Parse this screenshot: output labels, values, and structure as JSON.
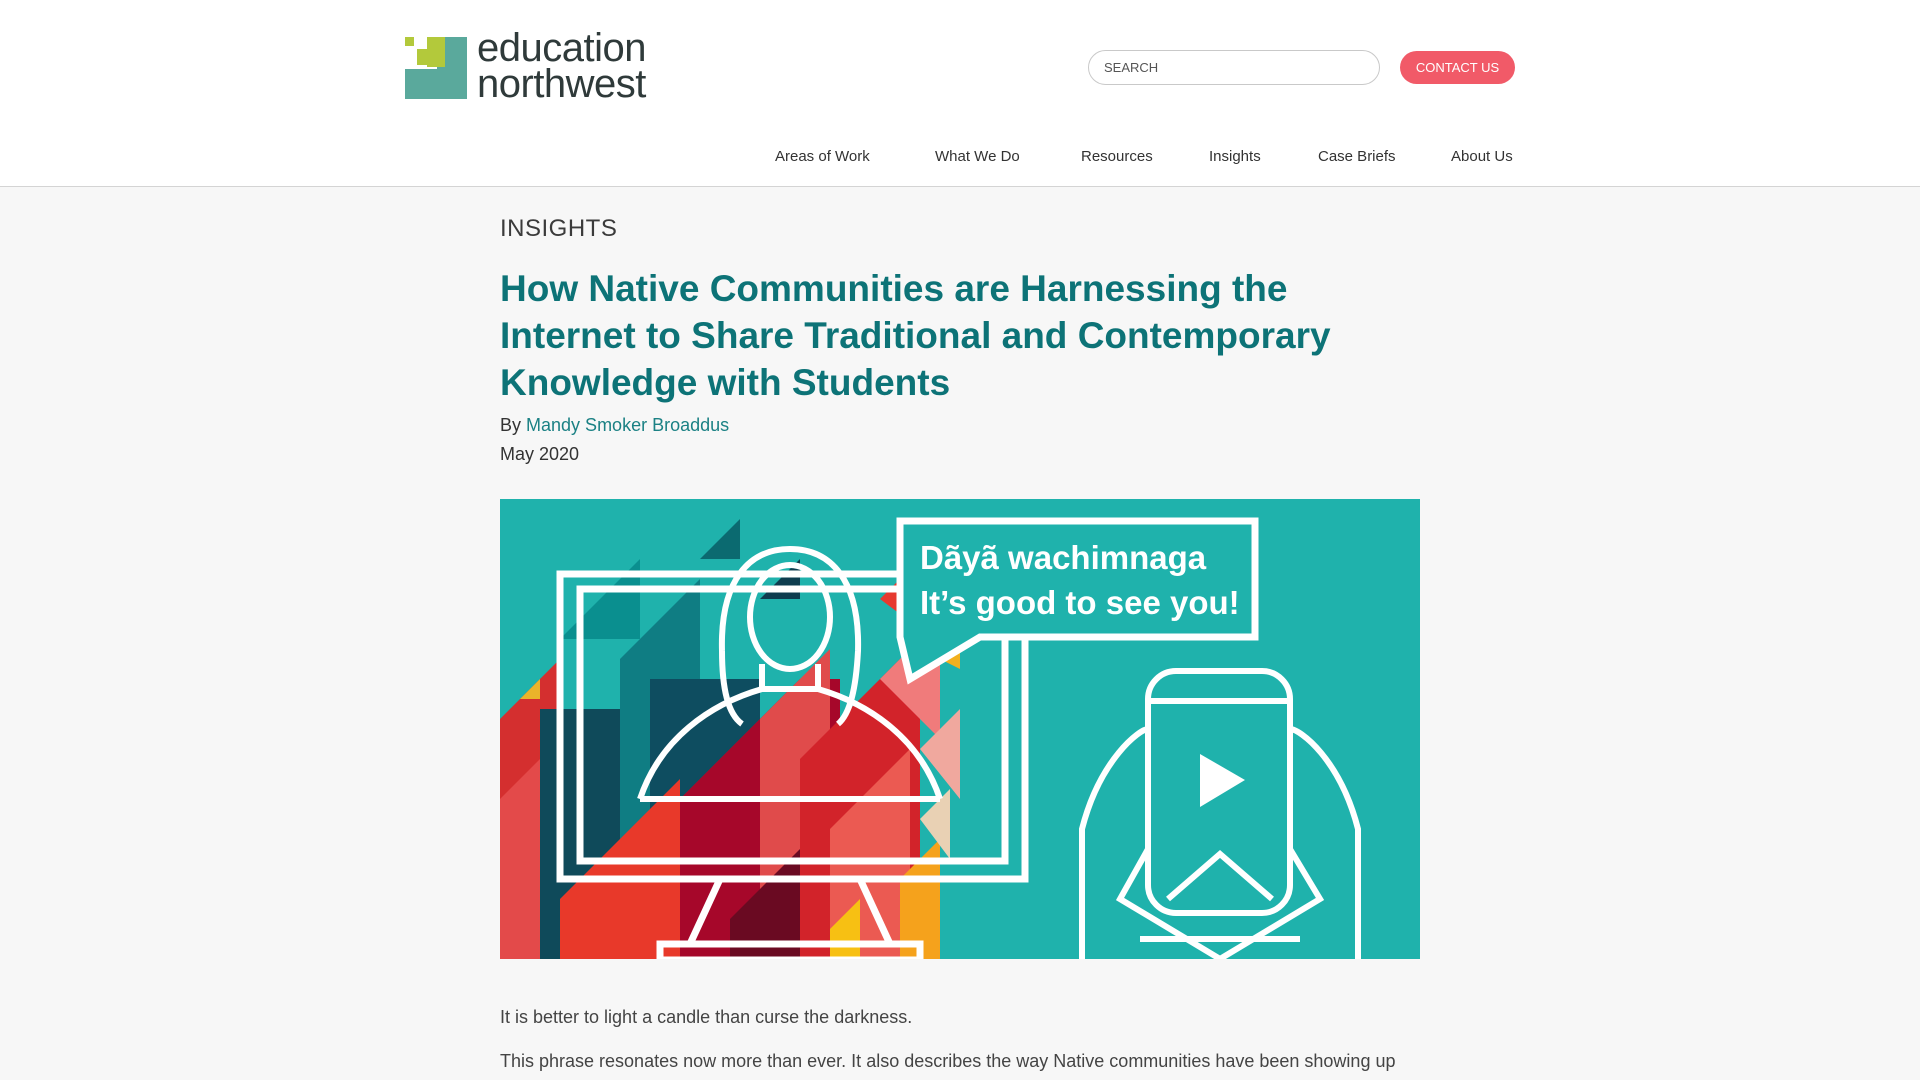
{
  "logo": {
    "line1": "education",
    "line2": "northwest"
  },
  "search": {
    "placeholder": "SEARCH"
  },
  "contact_label": "CONTACT US",
  "nav": {
    "items": [
      {
        "label": "Areas of Work"
      },
      {
        "label": "What We Do"
      },
      {
        "label": "Resources"
      },
      {
        "label": "Insights"
      },
      {
        "label": "Case Briefs"
      },
      {
        "label": "About Us"
      }
    ]
  },
  "article": {
    "section": "INSIGHTS",
    "title": "How Native Communities are Harnessing the Internet to Share Traditional and Contemporary Knowledge with Students",
    "by_prefix": "By",
    "author": "Mandy Smoker Broaddus",
    "date": "May 2020",
    "hero": {
      "bubble_line1": "Dãyã wachimnaga",
      "bubble_line2": "It’s good to see you!"
    },
    "paragraph1": "It is better to light a candle than curse the darkness.",
    "paragraph2": "This phrase resonates now more than ever. It also describes the way Native communities have been showing up"
  },
  "colors": {
    "brand_teal": "#0d7377",
    "hero_bg": "#1fb2ac",
    "contact_red": "#f15a68",
    "logo_green": "#b3c93b",
    "logo_teal": "#5aa99c"
  }
}
